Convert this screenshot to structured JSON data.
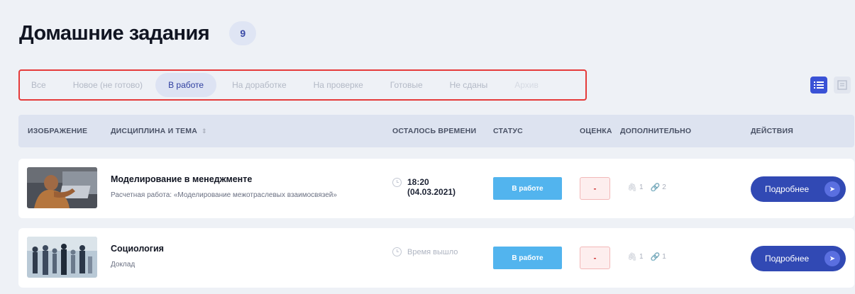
{
  "header": {
    "title": "Домашние задания",
    "count": "9"
  },
  "filters": [
    {
      "label": "Все",
      "state": "normal"
    },
    {
      "label": "Новое (не готово)",
      "state": "normal"
    },
    {
      "label": "В работе",
      "state": "active"
    },
    {
      "label": "На доработке",
      "state": "normal"
    },
    {
      "label": "На проверке",
      "state": "normal"
    },
    {
      "label": "Готовые",
      "state": "normal"
    },
    {
      "label": "Не сданы",
      "state": "normal"
    },
    {
      "label": "Архив",
      "state": "faded"
    }
  ],
  "view": {
    "selected": "list",
    "icons": [
      "list-icon",
      "grid-icon"
    ]
  },
  "table": {
    "headers": {
      "image": "ИЗОБРАЖЕНИЕ",
      "subject": "ДИСЦИПЛИНА И ТЕМА",
      "time": "ОСТАЛОСЬ ВРЕМЕНИ",
      "status": "СТАТУС",
      "grade": "ОЦЕНКА",
      "extra": "ДОПОЛНИТЕЛЬНО",
      "actions": "ДЕЙСТВИЯ"
    },
    "rows": [
      {
        "subject": "Моделирование в менеджменте",
        "topic": "Расчетная работа: «Моделирование межотраслевых взаимосвязей»",
        "time_line1": "18:20",
        "time_line2": "(04.03.2021)",
        "status": "В работе",
        "grade": "-",
        "files_count": "1",
        "links_count": "2",
        "action": "Подробнее"
      },
      {
        "subject": "Социология",
        "topic": "Доклад",
        "time_expired": "Время вышло",
        "status": "В работе",
        "grade": "-",
        "files_count": "1",
        "links_count": "1",
        "action": "Подробнее"
      }
    ]
  },
  "colors": {
    "accent": "#3149b4",
    "status": "#52b4ee",
    "highlight_border": "#e53a3a",
    "background": "#eef1f6"
  }
}
